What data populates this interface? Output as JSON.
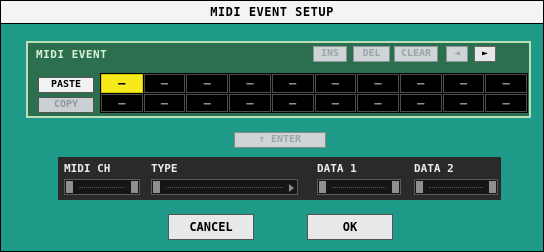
{
  "dialog": {
    "title": "MIDI EVENT SETUP"
  },
  "event_panel": {
    "label": "MIDI EVENT",
    "buttons": {
      "ins": "INS",
      "del": "DEL",
      "clear": "CLEAR",
      "left": "◄",
      "right": "►"
    },
    "side_buttons": {
      "paste": "PASTE",
      "copy": "COPY"
    },
    "grid": {
      "rows": [
        [
          "—",
          "—",
          "—",
          "—",
          "—",
          "—",
          "—",
          "—",
          "—",
          "—"
        ],
        [
          "—",
          "—",
          "—",
          "—",
          "—",
          "—",
          "—",
          "—",
          "—",
          "—"
        ]
      ],
      "selected": {
        "row": 0,
        "col": 0
      }
    }
  },
  "enter_button": "↑ ENTER",
  "fields": {
    "midi_ch": {
      "label": "MIDI CH",
      "value": ""
    },
    "type": {
      "label": "TYPE",
      "value": ""
    },
    "data1": {
      "label": "DATA 1",
      "value": ""
    },
    "data2": {
      "label": "DATA 2",
      "value": ""
    }
  },
  "footer": {
    "cancel": "CANCEL",
    "ok": "OK"
  },
  "colors": {
    "dialog_bg": "#1f9a88",
    "panel_bg": "#2b6f4f",
    "selected_cell": "#f6ea1d",
    "data_panel_bg": "#2a2a2a"
  }
}
